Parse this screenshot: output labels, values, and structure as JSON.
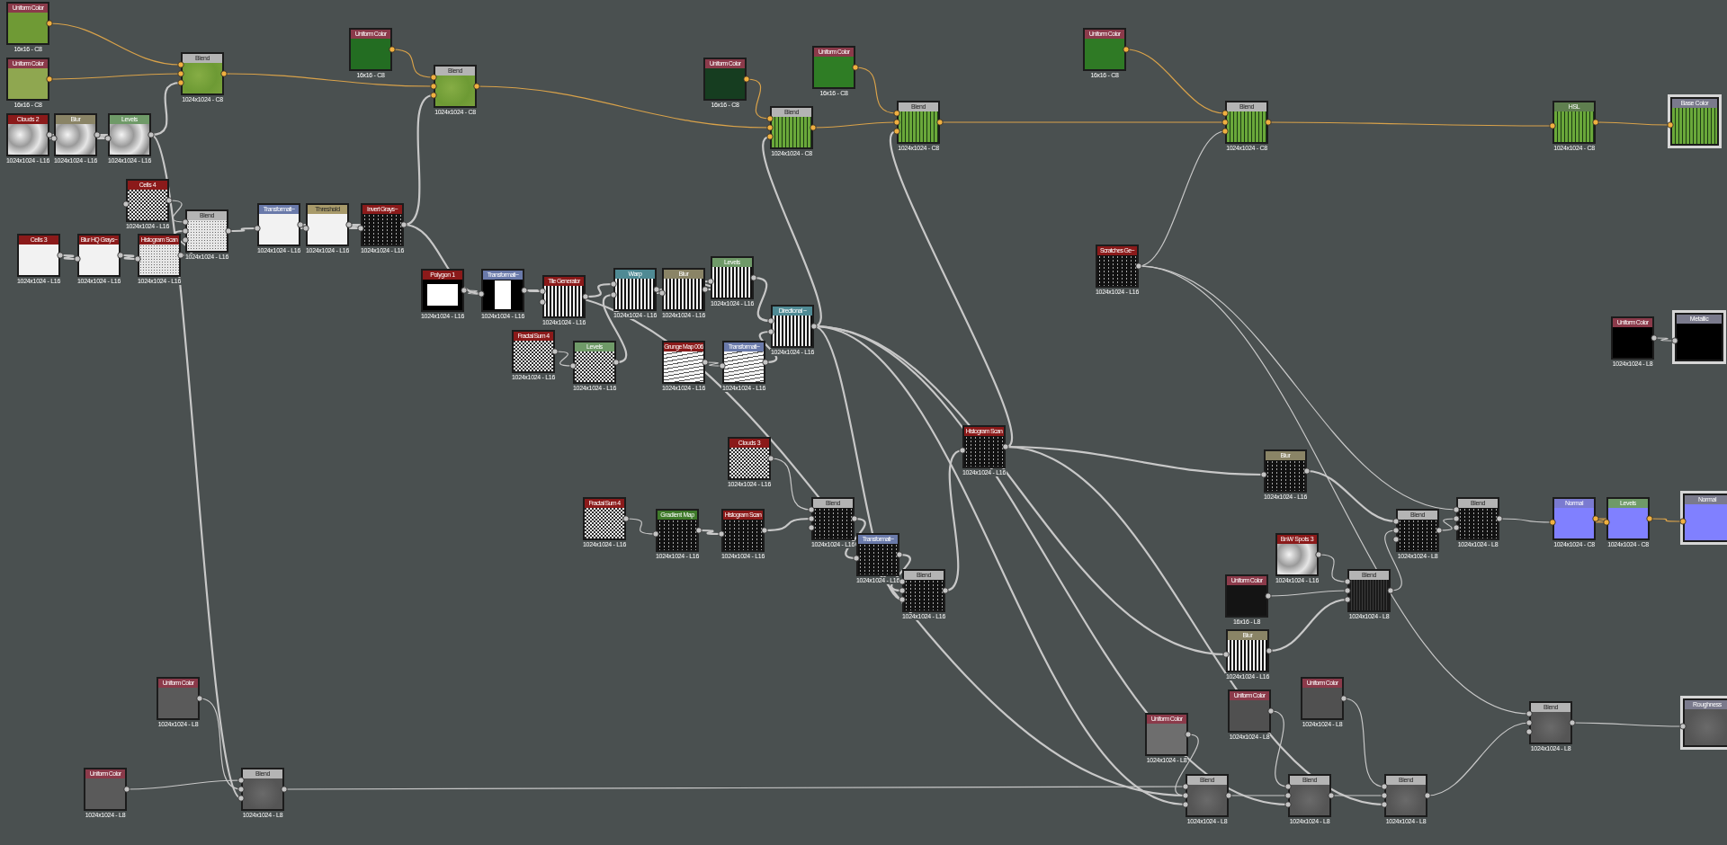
{
  "graph": {
    "nodes": [
      {
        "kind": "node",
        "title": "Uniform Color",
        "color": "#8b3a4a",
        "color_ports": true,
        "preview": {
          "kind": "solid",
          "color": "#6f9a35"
        },
        "footer": "16x16 - C8"
      },
      {
        "kind": "node",
        "title": "Uniform Color",
        "color": "#8b3a4a",
        "color_ports": true,
        "preview": {
          "kind": "solid",
          "color": "#8fa750"
        },
        "footer": "16x16 - C8"
      },
      {
        "kind": "node",
        "title": "Blend",
        "color": "#b4b4b4",
        "color_ports": true,
        "preview": {
          "kind": "green"
        },
        "footer": "1024x1024 - C8"
      },
      {
        "kind": "node",
        "title": "Clouds 2",
        "color": "#8b1a1a",
        "color_ports": false,
        "preview": {
          "kind": "clouds"
        },
        "footer": "1024x1024 - L16"
      },
      {
        "kind": "node",
        "title": "Blur",
        "color": "#8a8466",
        "color_ports": false,
        "preview": {
          "kind": "clouds"
        },
        "footer": "1024x1024 - L16"
      },
      {
        "kind": "node",
        "title": "Levels",
        "color": "#6f9a68",
        "color_ports": false,
        "preview": {
          "kind": "clouds"
        },
        "footer": "1024x1024 - L16"
      },
      {
        "kind": "node",
        "title": "Cells 4",
        "color": "#8b1a1a",
        "color_ports": false,
        "preview": {
          "kind": "noise"
        },
        "footer": "1024x1024 - L16"
      },
      {
        "kind": "node",
        "title": "Blend",
        "color": "#b4b4b4",
        "color_ports": false,
        "preview": {
          "kind": "speckle"
        },
        "footer": "1024x1024 - L16"
      },
      {
        "kind": "node",
        "title": "Cells 3",
        "color": "#8b1a1a",
        "color_ports": false,
        "preview": {
          "kind": "white"
        },
        "footer": "1024x1024 - L16"
      },
      {
        "kind": "node",
        "title": "Blur HQ Grays~",
        "color": "#8b1a1a",
        "color_ports": false,
        "preview": {
          "kind": "white"
        },
        "footer": "1024x1024 - L16"
      },
      {
        "kind": "node",
        "title": "Histogram Scan",
        "color": "#8b1a1a",
        "color_ports": false,
        "preview": {
          "kind": "speckle"
        },
        "footer": "1024x1024 - L16"
      },
      {
        "kind": "node",
        "title": "Transformati~",
        "color": "#6a7aaa",
        "color_ports": false,
        "preview": {
          "kind": "white"
        },
        "footer": "1024x1024 - L16"
      },
      {
        "kind": "node",
        "title": "Threshold",
        "color": "#a89a6a",
        "color_ports": false,
        "preview": {
          "kind": "white"
        },
        "footer": "1024x1024 - L16"
      },
      {
        "kind": "node",
        "title": "Uniform Color",
        "color": "#8b3a4a",
        "color_ports": true,
        "preview": {
          "kind": "solid",
          "color": "#236d22"
        },
        "footer": "16x16 - C8"
      },
      {
        "kind": "node",
        "title": "Invert Grays~",
        "color": "#8b1a1a",
        "color_ports": false,
        "preview": {
          "kind": "dark"
        },
        "footer": "1024x1024 - L16"
      },
      {
        "kind": "node",
        "title": "Blend",
        "color": "#b4b4b4",
        "color_ports": true,
        "preview": {
          "kind": "green"
        },
        "footer": "1024x1024 - C8"
      },
      {
        "kind": "node",
        "title": "Polygon 1",
        "color": "#8b1a1a",
        "color_ports": false,
        "preview": {
          "kind": "square"
        },
        "footer": "1024x1024 - L16"
      },
      {
        "kind": "node",
        "title": "Transformati~",
        "color": "#6a7aaa",
        "color_ports": false,
        "preview": {
          "kind": "bar"
        },
        "footer": "1024x1024 - L16"
      },
      {
        "kind": "node",
        "title": "Tile Generator",
        "color": "#8b1a1a",
        "color_ports": false,
        "preview": {
          "kind": "stripes"
        },
        "footer": "1024x1024 - L16"
      },
      {
        "kind": "node",
        "title": "Fractal Sum 4",
        "color": "#8b1a1a",
        "color_ports": false,
        "preview": {
          "kind": "noise"
        },
        "footer": "1024x1024 - L16"
      },
      {
        "kind": "node",
        "title": "Levels",
        "color": "#6f9a68",
        "color_ports": false,
        "preview": {
          "kind": "noise"
        },
        "footer": "1024x1024 - L16"
      },
      {
        "kind": "node",
        "title": "Warp",
        "color": "#4f8a94",
        "color_ports": false,
        "preview": {
          "kind": "stripes"
        },
        "footer": "1024x1024 - L16"
      },
      {
        "kind": "node",
        "title": "Blur",
        "color": "#8a8466",
        "color_ports": false,
        "preview": {
          "kind": "stripes"
        },
        "footer": "1024x1024 - L16"
      },
      {
        "kind": "node",
        "title": "Levels",
        "color": "#6f9a68",
        "color_ports": false,
        "preview": {
          "kind": "stripes"
        },
        "footer": "1024x1024 - L16"
      },
      {
        "kind": "node",
        "title": "Grunge Map 006",
        "color": "#8b1a1a",
        "color_ports": false,
        "preview": {
          "kind": "waves"
        },
        "footer": "1024x1024 - L16"
      },
      {
        "kind": "node",
        "title": "Transformati~",
        "color": "#6a7aaa",
        "color_ports": false,
        "preview": {
          "kind": "waves"
        },
        "footer": "1024x1024 - L16"
      },
      {
        "kind": "node",
        "title": "Directional ~",
        "color": "#4f8a94",
        "color_ports": false,
        "preview": {
          "kind": "stripes"
        },
        "footer": "1024x1024 - L16"
      },
      {
        "kind": "node",
        "title": "Uniform Color",
        "color": "#8b3a4a",
        "color_ports": true,
        "preview": {
          "kind": "solid",
          "color": "#163d20"
        },
        "footer": "16x16 - C8"
      },
      {
        "kind": "node",
        "title": "Uniform Color",
        "color": "#8b3a4a",
        "color_ports": true,
        "preview": {
          "kind": "solid",
          "color": "#2f7d25"
        },
        "footer": "16x16 - C8"
      },
      {
        "kind": "node",
        "title": "Blend",
        "color": "#b4b4b4",
        "color_ports": true,
        "preview": {
          "kind": "greenstripes"
        },
        "footer": "1024x1024 - C8"
      },
      {
        "kind": "node",
        "title": "Blend",
        "color": "#b4b4b4",
        "color_ports": true,
        "preview": {
          "kind": "greenstripes"
        },
        "footer": "1024x1024 - C8"
      },
      {
        "kind": "node",
        "title": "Uniform Color",
        "color": "#8b3a4a",
        "color_ports": true,
        "preview": {
          "kind": "solid",
          "color": "#2f7a25"
        },
        "footer": "16x16 - C8"
      },
      {
        "kind": "node",
        "title": "Blend",
        "color": "#b4b4b4",
        "color_ports": true,
        "preview": {
          "kind": "greenstripes"
        },
        "footer": "1024x1024 - C8"
      },
      {
        "kind": "node",
        "title": "HSL",
        "color": "#5f7f4f",
        "color_ports": true,
        "preview": {
          "kind": "greenstripes"
        },
        "footer": "1024x1024 - C8"
      },
      {
        "kind": "output",
        "title": "Base Color",
        "color": "#7a7a8c",
        "color_ports": true,
        "preview": {
          "kind": "greenstripes"
        }
      },
      {
        "kind": "node",
        "title": "Scratches Ge~",
        "color": "#8b1a1a",
        "color_ports": false,
        "preview": {
          "kind": "dark"
        },
        "footer": "1024x1024 - L16"
      },
      {
        "kind": "node",
        "title": "Uniform Color",
        "color": "#8b3a4a",
        "color_ports": false,
        "preview": {
          "kind": "solid",
          "color": "#000000"
        },
        "footer": "1024x1024 - L8"
      },
      {
        "kind": "output",
        "title": "Metallic",
        "color": "#7a7a8c",
        "color_ports": false,
        "preview": {
          "kind": "solid",
          "color": "#000000"
        }
      },
      {
        "kind": "node",
        "title": "Clouds 3",
        "color": "#8b1a1a",
        "color_ports": false,
        "preview": {
          "kind": "noise"
        },
        "footer": "1024x1024 - L16"
      },
      {
        "kind": "node",
        "title": "Fractal Sum 4",
        "color": "#8b1a1a",
        "color_ports": false,
        "preview": {
          "kind": "noise"
        },
        "footer": "1024x1024 - L16"
      },
      {
        "kind": "node",
        "title": "Gradient Map",
        "color": "#3f7a2a",
        "color_ports": false,
        "preview": {
          "kind": "dark"
        },
        "footer": "1024x1024 - L16"
      },
      {
        "kind": "node",
        "title": "Histogram Scan",
        "color": "#8b1a1a",
        "color_ports": false,
        "preview": {
          "kind": "dark"
        },
        "footer": "1024x1024 - L16"
      },
      {
        "kind": "node",
        "title": "Blend",
        "color": "#b4b4b4",
        "color_ports": false,
        "preview": {
          "kind": "dark"
        },
        "footer": "1024x1024 - L16"
      },
      {
        "kind": "node",
        "title": "Transformati~",
        "color": "#6a7aaa",
        "color_ports": false,
        "preview": {
          "kind": "dark"
        },
        "footer": "1024x1024 - L16"
      },
      {
        "kind": "node",
        "title": "Blend",
        "color": "#b4b4b4",
        "color_ports": false,
        "preview": {
          "kind": "dark"
        },
        "footer": "1024x1024 - L16"
      },
      {
        "kind": "node",
        "title": "Histogram Scan",
        "color": "#8b1a1a",
        "color_ports": false,
        "preview": {
          "kind": "dark"
        },
        "footer": "1024x1024 - L16"
      },
      {
        "kind": "node",
        "title": "Blur",
        "color": "#8a8466",
        "color_ports": false,
        "preview": {
          "kind": "dark"
        },
        "footer": "1024x1024 - L16"
      },
      {
        "kind": "node",
        "title": "BnW Spots 3",
        "color": "#8b1a1a",
        "color_ports": false,
        "preview": {
          "kind": "clouds"
        },
        "footer": "1024x1024 - L16"
      },
      {
        "kind": "node",
        "title": "Uniform Color",
        "color": "#8b3a4a",
        "color_ports": false,
        "preview": {
          "kind": "solid",
          "color": "#141414"
        },
        "footer": "16x16 - L8"
      },
      {
        "kind": "node",
        "title": "Blend",
        "color": "#b4b4b4",
        "color_ports": false,
        "preview": {
          "kind": "darkstripes"
        },
        "footer": "1024x1024 - L8"
      },
      {
        "kind": "node",
        "title": "Blur",
        "color": "#8a8466",
        "color_ports": false,
        "preview": {
          "kind": "stripes"
        },
        "footer": "1024x1024 - L16"
      },
      {
        "kind": "node",
        "title": "Blend",
        "color": "#b4b4b4",
        "color_ports": false,
        "preview": {
          "kind": "dark"
        },
        "footer": "1024x1024 - L8"
      },
      {
        "kind": "node",
        "title": "Blend",
        "color": "#b4b4b4",
        "color_ports": false,
        "preview": {
          "kind": "dark"
        },
        "footer": "1024x1024 - L8"
      },
      {
        "kind": "node",
        "title": "Normal",
        "color": "#7a7ad0",
        "color_ports": true,
        "preview": {
          "kind": "solid",
          "color": "#8080ff"
        },
        "footer": "1024x1024 - C8"
      },
      {
        "kind": "node",
        "title": "Levels",
        "color": "#6f9a68",
        "color_ports": true,
        "preview": {
          "kind": "solid",
          "color": "#8080ff"
        },
        "footer": "1024x1024 - C8"
      },
      {
        "kind": "output",
        "title": "Normal",
        "color": "#7a7a8c",
        "color_ports": true,
        "preview": {
          "kind": "solid",
          "color": "#8080ff"
        }
      },
      {
        "kind": "node",
        "title": "Uniform Color",
        "color": "#8b3a4a",
        "color_ports": false,
        "preview": {
          "kind": "solid",
          "color": "#5a5a5a"
        },
        "footer": "1024x1024 - L8"
      },
      {
        "kind": "node",
        "title": "Uniform Color",
        "color": "#8b3a4a",
        "color_ports": false,
        "preview": {
          "kind": "solid",
          "color": "#5a5a5a"
        },
        "footer": "1024x1024 - L8"
      },
      {
        "kind": "node",
        "title": "Blend",
        "color": "#b4b4b4",
        "color_ports": false,
        "preview": {
          "kind": "gray"
        },
        "footer": "1024x1024 - L8"
      },
      {
        "kind": "node",
        "title": "Uniform Color",
        "color": "#8b3a4a",
        "color_ports": false,
        "preview": {
          "kind": "solid",
          "color": "#6e6e6e"
        },
        "footer": "1024x1024 - L8"
      },
      {
        "kind": "node",
        "title": "Uniform Color",
        "color": "#8b3a4a",
        "color_ports": false,
        "preview": {
          "kind": "solid",
          "color": "#505050"
        },
        "footer": "1024x1024 - L8"
      },
      {
        "kind": "node",
        "title": "Uniform Color",
        "color": "#8b3a4a",
        "color_ports": false,
        "preview": {
          "kind": "solid",
          "color": "#505050"
        },
        "footer": "1024x1024 - L8"
      },
      {
        "kind": "node",
        "title": "Blend",
        "color": "#b4b4b4",
        "color_ports": false,
        "preview": {
          "kind": "gray"
        },
        "footer": "1024x1024 - L8"
      },
      {
        "kind": "node",
        "title": "Blend",
        "color": "#b4b4b4",
        "color_ports": false,
        "preview": {
          "kind": "gray"
        },
        "footer": "1024x1024 - L8"
      },
      {
        "kind": "node",
        "title": "Blend",
        "color": "#b4b4b4",
        "color_ports": false,
        "preview": {
          "kind": "gray"
        },
        "footer": "1024x1024 - L8"
      },
      {
        "kind": "node",
        "title": "Blend",
        "color": "#b4b4b4",
        "color_ports": false,
        "preview": {
          "kind": "gray"
        },
        "footer": "1024x1024 - L8"
      },
      {
        "kind": "output",
        "title": "Roughness",
        "color": "#7a7a8c",
        "color_ports": false,
        "preview": {
          "kind": "gray"
        }
      }
    ]
  }
}
